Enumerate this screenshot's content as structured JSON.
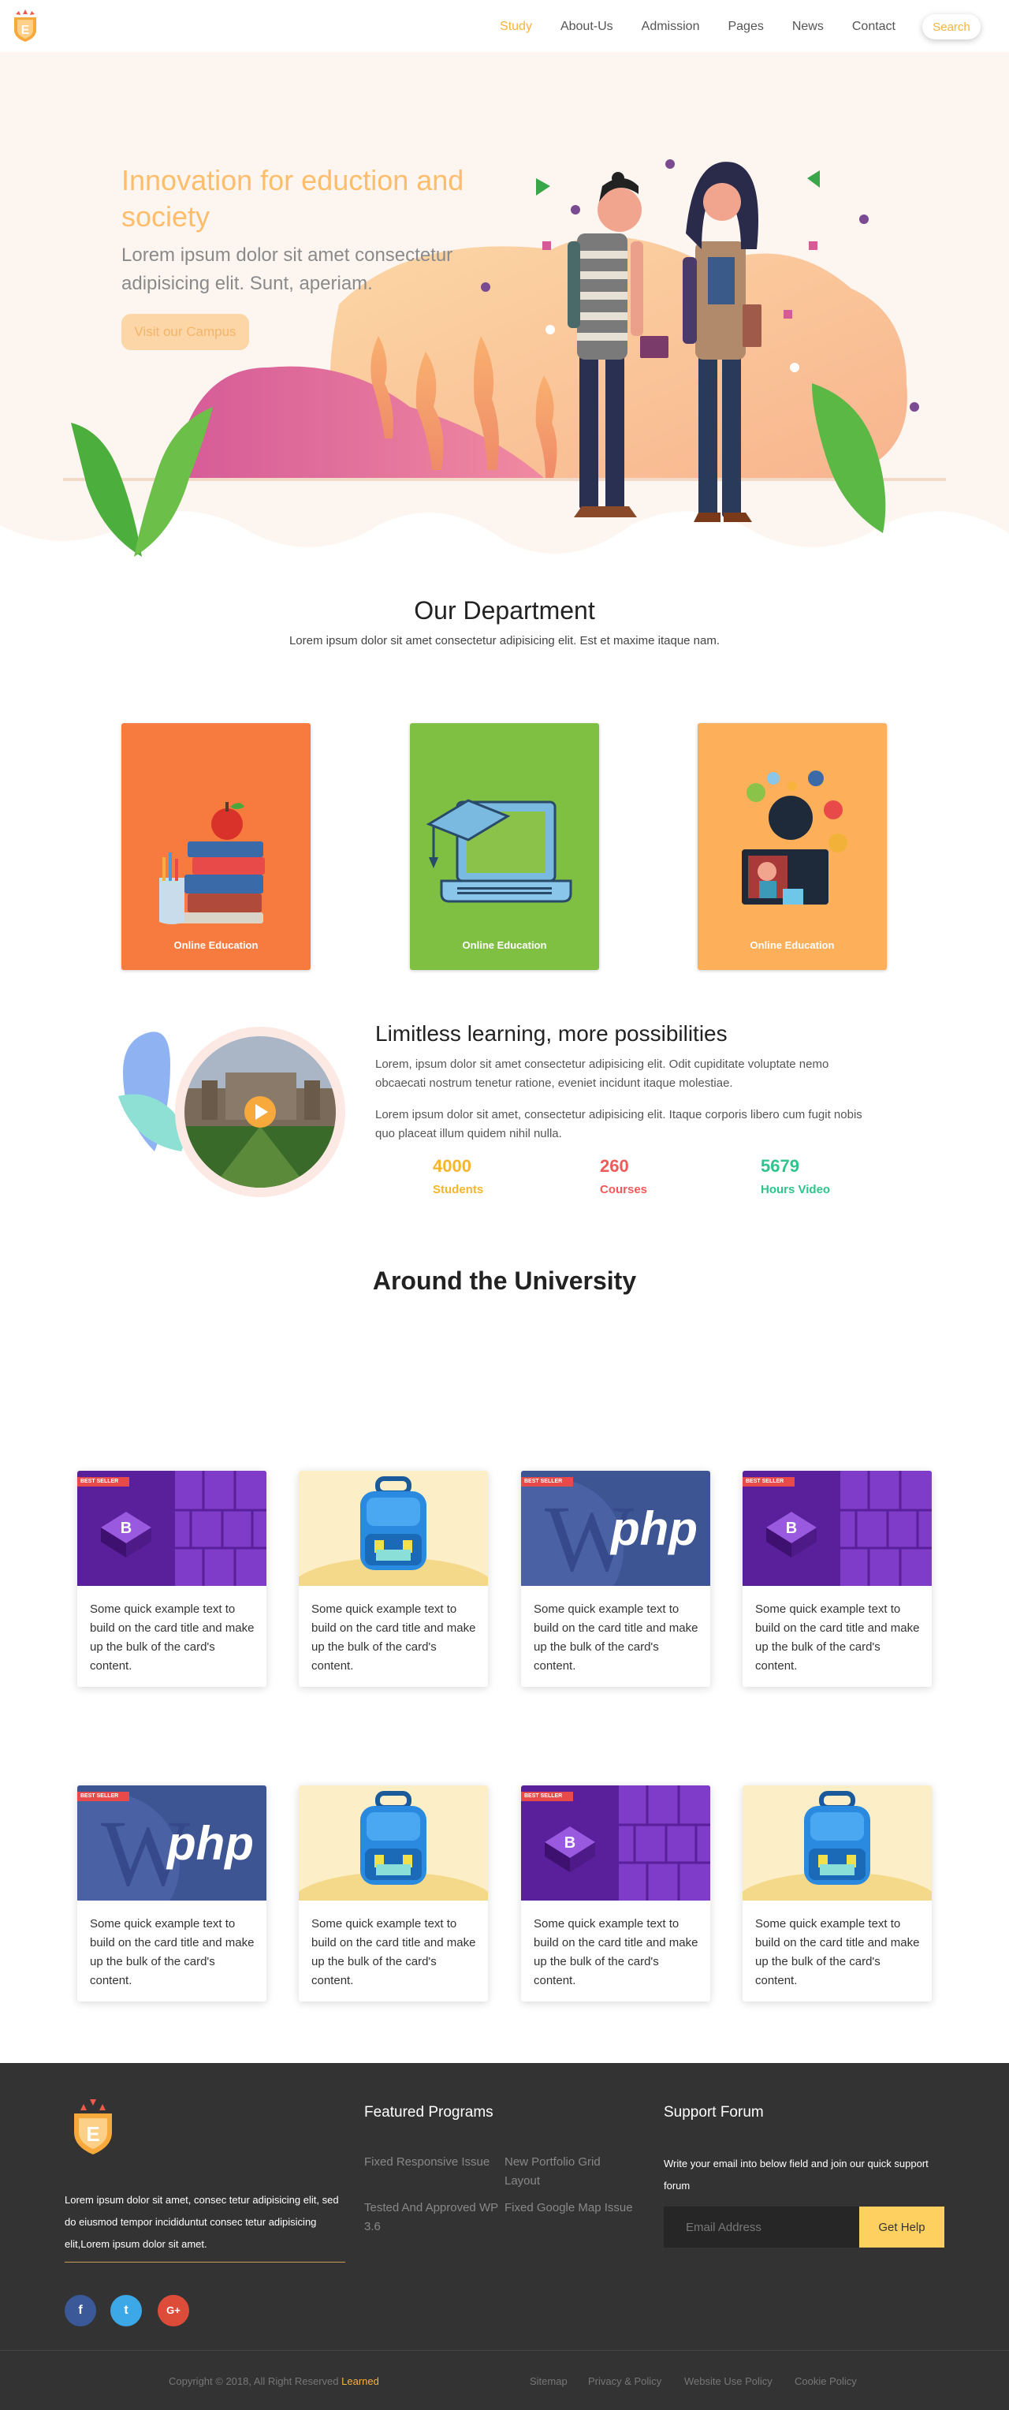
{
  "nav": {
    "items": [
      {
        "label": "Study",
        "active": true
      },
      {
        "label": "About-Us",
        "active": false
      },
      {
        "label": "Admission",
        "active": false
      },
      {
        "label": "Pages",
        "active": false
      },
      {
        "label": "News",
        "active": false
      },
      {
        "label": "Contact",
        "active": false
      }
    ],
    "search_label": "Search",
    "logo_icon": "shield-e-logo-icon"
  },
  "hero": {
    "title": "Innovation for eduction and society",
    "subtitle": "Lorem ipsum dolor sit amet consectetur adipisicing elit. Sunt, aperiam.",
    "button": "Visit our Campus"
  },
  "department": {
    "title": "Our Department",
    "subtitle": "Lorem ipsum dolor sit amet consectetur adipisicing elit. Est et maxime itaque nam.",
    "cards": [
      {
        "caption": "Online Education",
        "color": "#f77b3e",
        "icon": "books-apple-icon"
      },
      {
        "caption": "Online Education",
        "color": "#7fc043",
        "icon": "laptop-graduation-cap-icon"
      },
      {
        "caption": "Online Education",
        "color": "#feaf5a",
        "icon": "online-tutor-icon"
      }
    ]
  },
  "limitless": {
    "title": "Limitless learning, more possibilities",
    "p1": "Lorem, ipsum dolor sit amet consectetur adipisicing elit. Odit cupiditate voluptate nemo obcaecati nostrum tenetur ratione, eveniet incidunt itaque molestiae.",
    "p2": "Lorem ipsum dolor sit amet, consectetur adipisicing elit. Itaque corporis libero cum fugit nobis quo placeat illum quidem nihil nulla.",
    "stats": [
      {
        "value": "4000",
        "label": "Students",
        "color": "#f7b52c"
      },
      {
        "value": "260",
        "label": "Courses",
        "color": "#ef5a5a"
      },
      {
        "value": "5679",
        "label": "Hours Video",
        "color": "#2fc48d"
      }
    ]
  },
  "around": {
    "title": "Around the University",
    "badge": "BEST SELLER",
    "php_text": "php",
    "card_text": "Some quick example text to build on the card title and make up the bulk of the card's content.",
    "row1": [
      "bootstrap",
      "backpack",
      "php",
      "bootstrap"
    ],
    "row2": [
      "php",
      "backpack",
      "bootstrap",
      "backpack"
    ]
  },
  "footer": {
    "about": "Lorem ipsum dolor sit amet, consec tetur adipisicing elit, sed do eiusmod tempor incididuntut consec tetur adipisicing elit,Lorem ipsum dolor sit amet.",
    "social": [
      {
        "glyph": "f",
        "icon": "facebook-icon",
        "color": "#3b5998"
      },
      {
        "glyph": "t",
        "icon": "twitter-icon",
        "color": "#3ca8e8"
      },
      {
        "glyph": "G+",
        "icon": "google-plus-icon",
        "color": "#dd4b39"
      }
    ],
    "featured_title": "Featured Programs",
    "featured_links": [
      "Fixed Responsive Issue",
      "Tested And Approved WP 3.6",
      "New Portfolio Grid Layout",
      "Fixed Google Map Issue"
    ],
    "support_title": "Support Forum",
    "support_text": "Write your email into below field and join our quick support forum",
    "email_placeholder": "Email Address",
    "help_button": "Get Help",
    "copyright": "Copyright © 2018, All Right Reserved",
    "copyright_brand": "Learned",
    "bottom_links": [
      "Sitemap",
      "Privacy & Policy",
      "Website Use Policy",
      "Cookie Policy"
    ]
  }
}
